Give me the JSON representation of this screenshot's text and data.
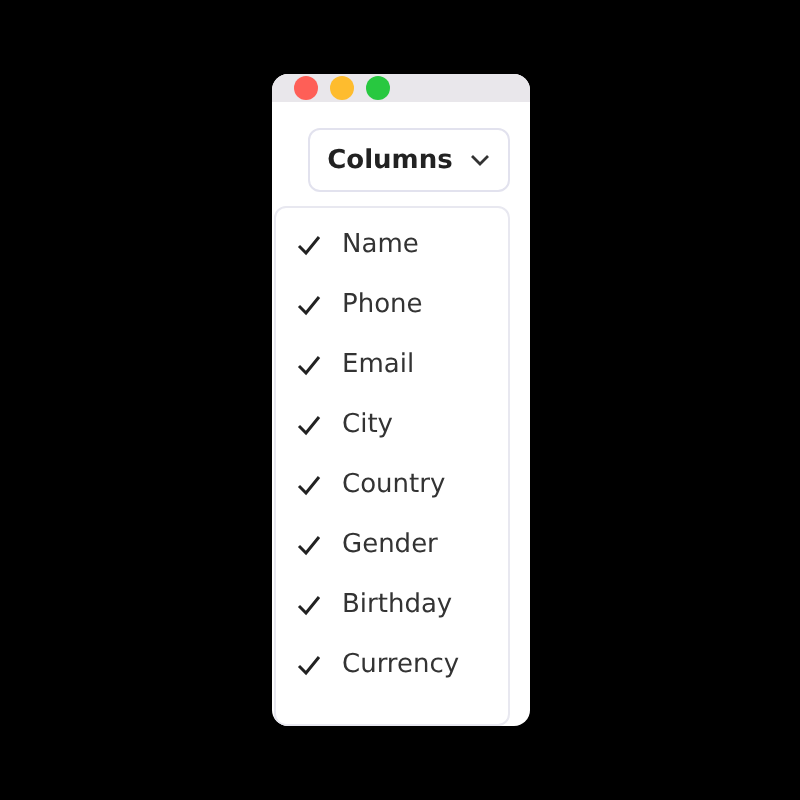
{
  "button": {
    "label": "Columns"
  },
  "columns": [
    {
      "label": "Name",
      "checked": true
    },
    {
      "label": "Phone",
      "checked": true
    },
    {
      "label": "Email",
      "checked": true
    },
    {
      "label": "City",
      "checked": true
    },
    {
      "label": "Country",
      "checked": true
    },
    {
      "label": "Gender",
      "checked": true
    },
    {
      "label": "Birthday",
      "checked": true
    },
    {
      "label": "Currency",
      "checked": true
    }
  ]
}
